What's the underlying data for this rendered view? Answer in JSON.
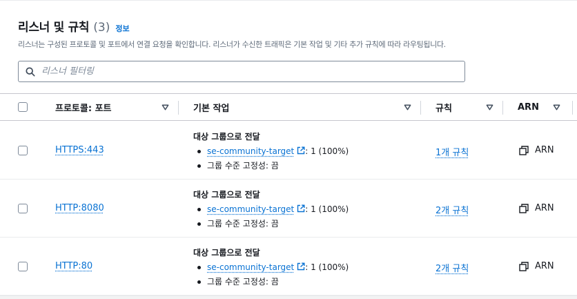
{
  "section": {
    "title": "리스너 및 규칙",
    "count": "(3)",
    "info_link": "정보",
    "description": "리스너는 구성된 프로토콜 및 포트에서 연결 요청을 확인합니다. 리스너가 수신한 트래픽은 기본 작업 및 기타 추가 규칙에 따라 라우팅됩니다."
  },
  "filter": {
    "placeholder": "리스너 필터링",
    "value": ""
  },
  "table": {
    "columns": {
      "protocol_port": "프로토콜: 포트",
      "default_action": "기본 작업",
      "rules": "규칙",
      "arn": "ARN"
    },
    "rows": [
      {
        "protocol_port": "HTTPS:443",
        "action_title": "대상 그룹으로 전달",
        "target_group": "se-community-target",
        "weight": ": 1 (100%)",
        "stickiness": "그룹 수준 고정성: 끔",
        "rules": "1개 규칙",
        "arn": "ARN"
      },
      {
        "protocol_port": "HTTP:8080",
        "action_title": "대상 그룹으로 전달",
        "target_group": "se-community-target",
        "weight": ": 1 (100%)",
        "stickiness": "그룹 수준 고정성: 끔",
        "rules": "2개 규칙",
        "arn": "ARN"
      },
      {
        "protocol_port": "HTTP:80",
        "action_title": "대상 그룹으로 전달",
        "target_group": "se-community-target",
        "weight": ": 1 (100%)",
        "stickiness": "그룹 수준 고정성: 끔",
        "rules": "2개 규칙",
        "arn": "ARN"
      }
    ]
  },
  "icons": {
    "search": "search-icon",
    "sort": "caret-down-icon",
    "external": "external-link-icon",
    "copy": "copy-icon"
  },
  "colors": {
    "link": "#0972d3",
    "text": "#16191f",
    "muted": "#5f6b7a",
    "border": "#c6c6cd"
  }
}
